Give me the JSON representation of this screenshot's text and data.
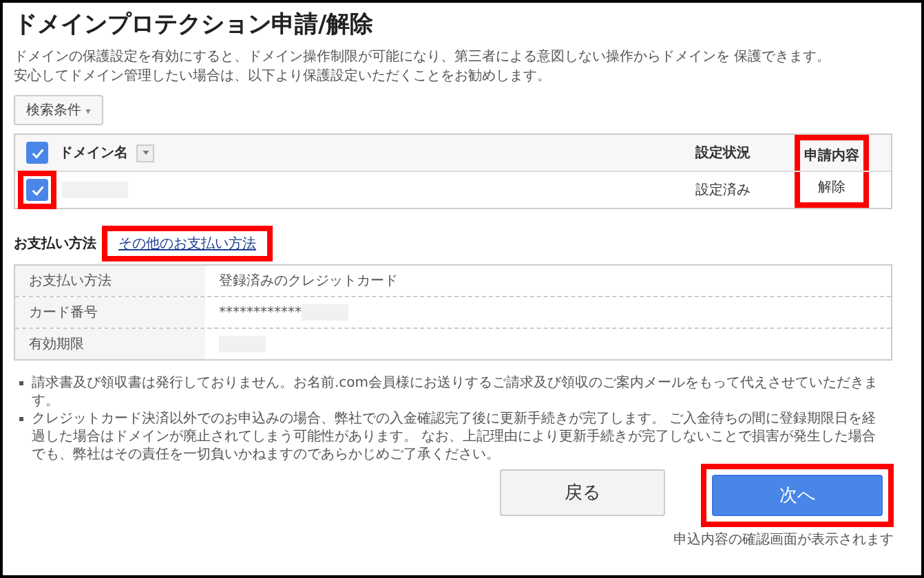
{
  "title": "ドメインプロテクション申請/解除",
  "description": [
    "ドメインの保護設定を有効にすると、ドメイン操作制限が可能になり、第三者による意図しない操作からドメインを 保護できます。",
    "安心してドメイン管理したい場合は、以下より保護設定いただくことをお勧めします。"
  ],
  "search_button": {
    "label": "検索条件",
    "caret": "▾"
  },
  "domain_table": {
    "all_checked": true,
    "columns": [
      {
        "label": "ドメイン名",
        "highlighted": false
      },
      {
        "label": "設定状況",
        "highlighted": false
      },
      {
        "label": "申請内容",
        "highlighted": true
      }
    ],
    "rows": [
      {
        "checked": true,
        "highlighted": true,
        "status": "設定済み",
        "request": "解除"
      }
    ]
  },
  "payment": {
    "heading": "お支払い方法",
    "other_link": "その他のお支払い方法",
    "link_highlighted": true,
    "rows": [
      {
        "label": "お支払い方法",
        "value": "登録済みのクレジットカード",
        "redacted": false
      },
      {
        "label": "カード番号",
        "value": "************",
        "redacted": true
      },
      {
        "label": "有効期限",
        "value": "",
        "redacted": true
      }
    ]
  },
  "notes": [
    "請求書及び領収書は発行しておりません。お名前.com会員様にお送りするご請求及び領収のご案内メールをもって代えさせていただきます。",
    "クレジットカード決済以外でのお申込みの場合、弊社での入金確認完了後に更新手続きが完了します。 ご入金待ちの間に登録期限日を経過した場合はドメインが廃止されてしまう可能性があります。 なお、上記理由により更新手続きが完了しないことで損害が発生した場合でも、弊社はその責任を一切負いかねますのであらかじめご了承ください。"
  ],
  "back_button": "戻る",
  "next_button": {
    "label": "次へ",
    "highlighted": true
  },
  "next_hint": "申込内容の確認画面が表示されます"
}
